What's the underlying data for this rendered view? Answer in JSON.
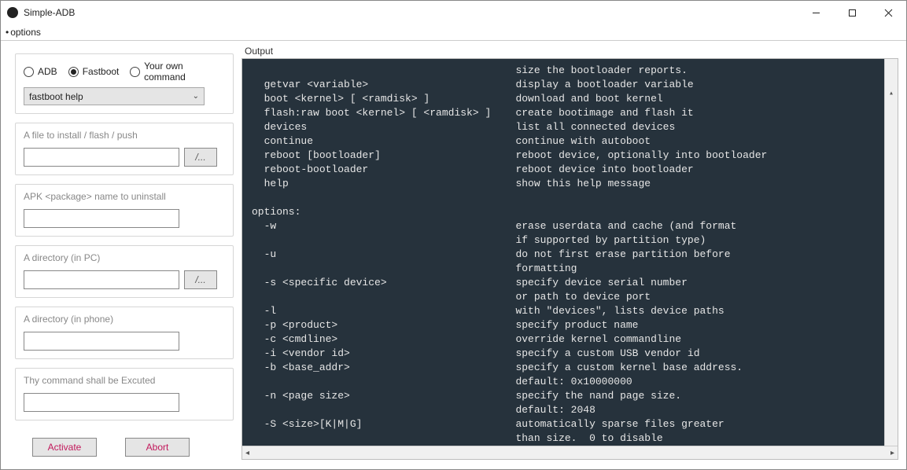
{
  "window": {
    "title": "Simple-ADB"
  },
  "menu": {
    "options": "options"
  },
  "mode": {
    "adb": "ADB",
    "fastboot": "Fastboot",
    "own": "Your own command",
    "selected": "fastboot"
  },
  "combo": {
    "value": "fastboot help"
  },
  "groups": {
    "file": {
      "label": "A file to install / flash / push",
      "browse": "/..."
    },
    "apk": {
      "label": "APK <package> name to uninstall"
    },
    "dir_pc": {
      "label": "A directory (in PC)",
      "browse": "/..."
    },
    "dir_phone": {
      "label": "A directory (in phone)"
    },
    "cmd": {
      "label": "Thy command shall be Excuted"
    }
  },
  "buttons": {
    "activate": "Activate",
    "abort": "Abort"
  },
  "output": {
    "label": "Output",
    "text": "                                           size the bootloader reports.\n  getvar <variable>                        display a bootloader variable\n  boot <kernel> [ <ramdisk> ]              download and boot kernel\n  flash:raw boot <kernel> [ <ramdisk> ]    create bootimage and flash it\n  devices                                  list all connected devices\n  continue                                 continue with autoboot\n  reboot [bootloader]                      reboot device, optionally into bootloader\n  reboot-bootloader                        reboot device into bootloader\n  help                                     show this help message\n\noptions:\n  -w                                       erase userdata and cache (and format\n                                           if supported by partition type)\n  -u                                       do not first erase partition before\n                                           formatting\n  -s <specific device>                     specify device serial number\n                                           or path to device port\n  -l                                       with \"devices\", lists device paths\n  -p <product>                             specify product name\n  -c <cmdline>                             override kernel commandline\n  -i <vendor id>                           specify a custom USB vendor id\n  -b <base_addr>                           specify a custom kernel base address.\n                                           default: 0x10000000\n  -n <page size>                           specify the nand page size.\n                                           default: 2048\n  -S <size>[K|M|G]                         automatically sparse files greater\n                                           than size.  0 to disable"
  }
}
